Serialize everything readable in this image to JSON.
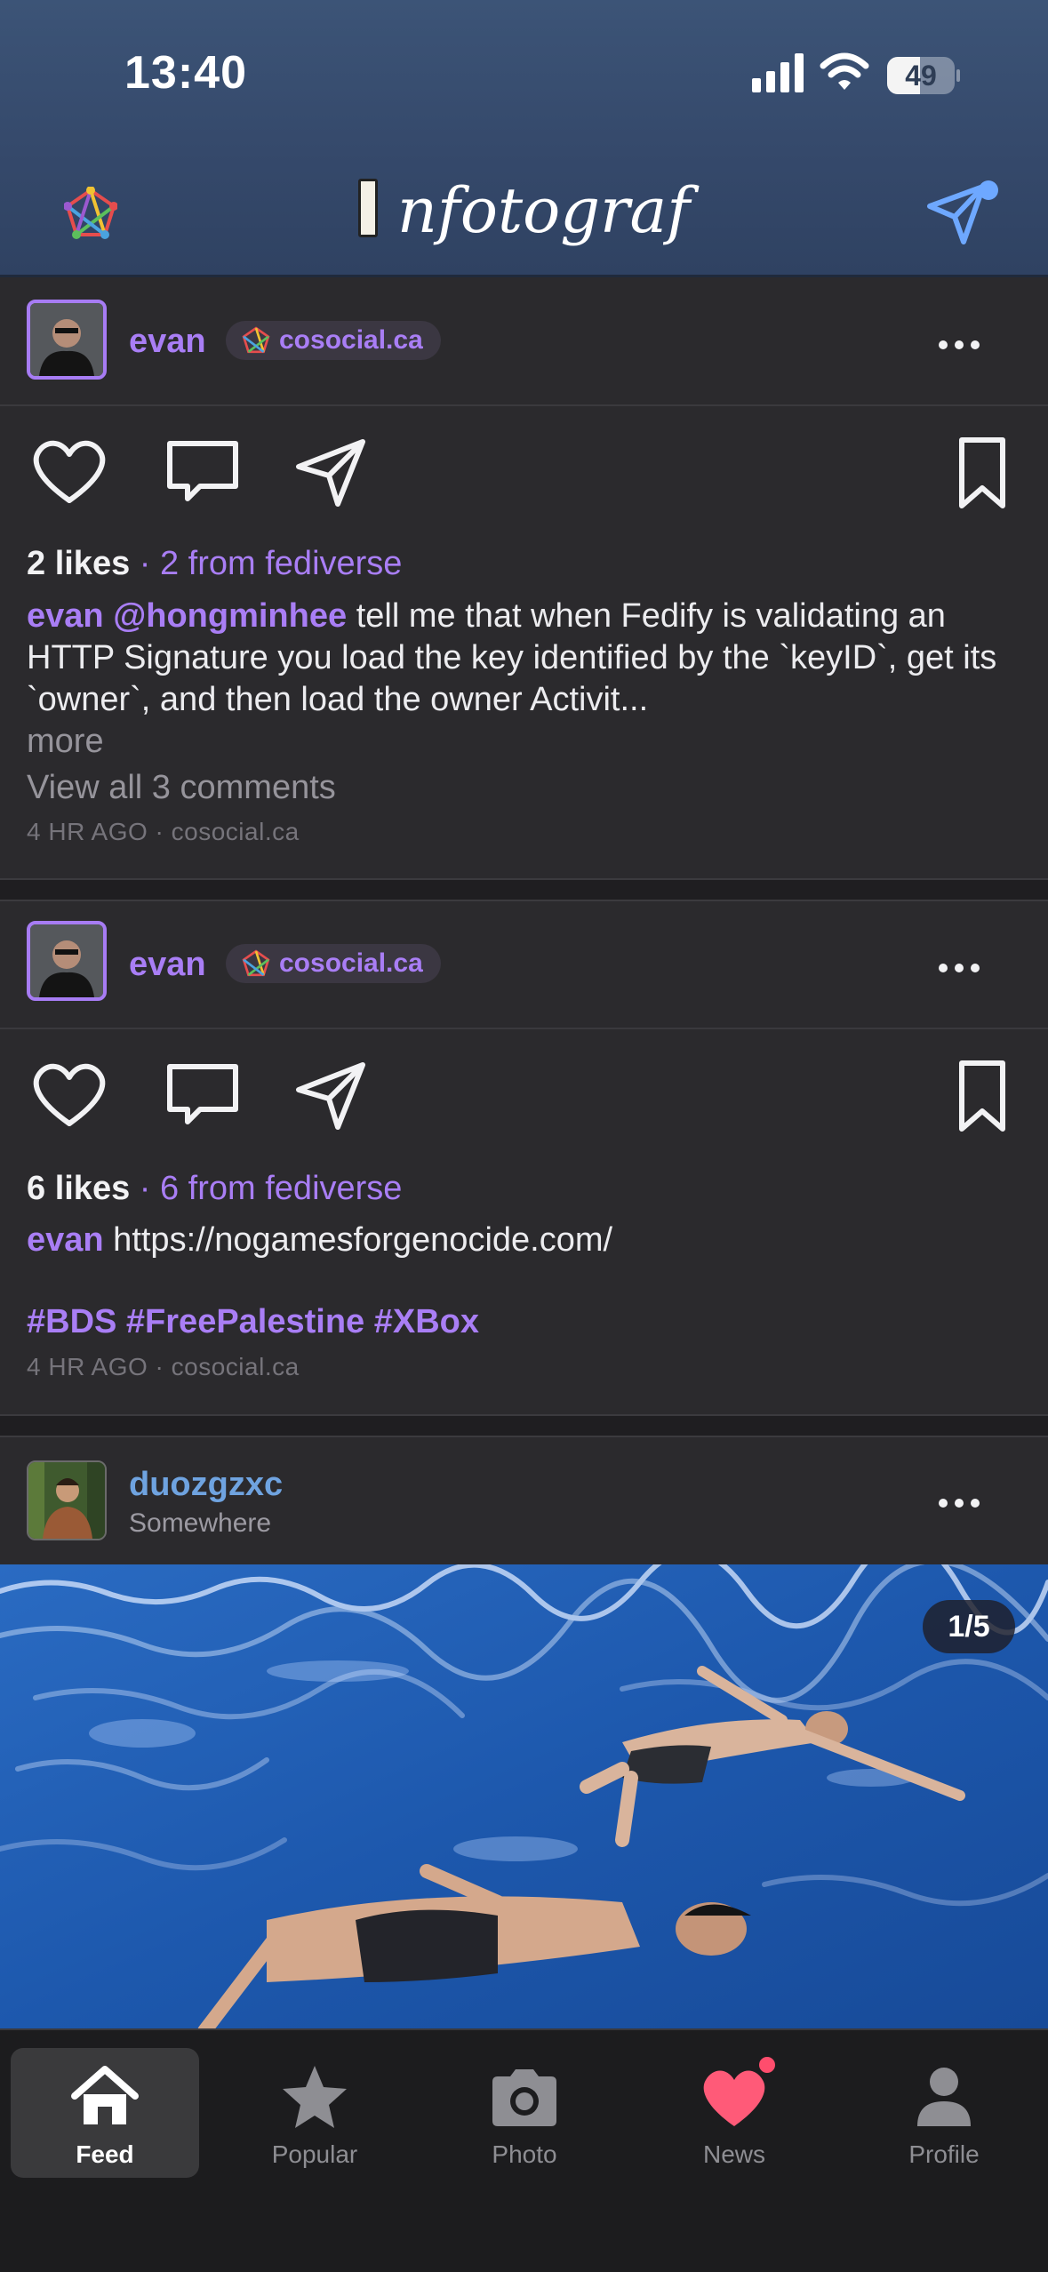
{
  "status_bar": {
    "time": "13:40",
    "battery": "49",
    "battery_level": 0.49
  },
  "header": {
    "title": "nfotograf"
  },
  "posts": [
    {
      "username": "evan",
      "instance": "cosocial.ca",
      "likes": "2 likes",
      "fediverse": "· 2 from fediverse",
      "caption_user": "evan",
      "caption_mention": "@hongminhee",
      "caption_text": " tell me that when Fedify is validating an HTTP Signature you load the key identified by the `keyID`, get its `owner`, and then load the owner Activit...",
      "more": "more",
      "view_comments": "View all 3 comments",
      "time": "4 HR AGO",
      "meta_instance": "cosocial.ca"
    },
    {
      "username": "evan",
      "instance": "cosocial.ca",
      "likes": "6 likes",
      "fediverse": "· 6 from fediverse",
      "caption_user": "evan",
      "caption_text": " https://nogamesforgenocide.com/",
      "tags": "#BDS #FreePalestine #XBox",
      "time": "4 HR AGO",
      "meta_instance": "cosocial.ca"
    },
    {
      "username": "duozgzxc",
      "location": "Somewhere",
      "photo_counter": "1/5"
    }
  ],
  "tabs": [
    {
      "label": "Feed",
      "icon": "home-icon",
      "active": true
    },
    {
      "label": "Popular",
      "icon": "star-icon"
    },
    {
      "label": "Photo",
      "icon": "camera-icon"
    },
    {
      "label": "News",
      "icon": "heart-icon",
      "badge": true
    },
    {
      "label": "Profile",
      "icon": "person-icon"
    }
  ],
  "colors": {
    "accent": "#a97ef5",
    "header": "#3c5477",
    "background": "#2b2a2d",
    "news_heart": "#ff5a78"
  }
}
